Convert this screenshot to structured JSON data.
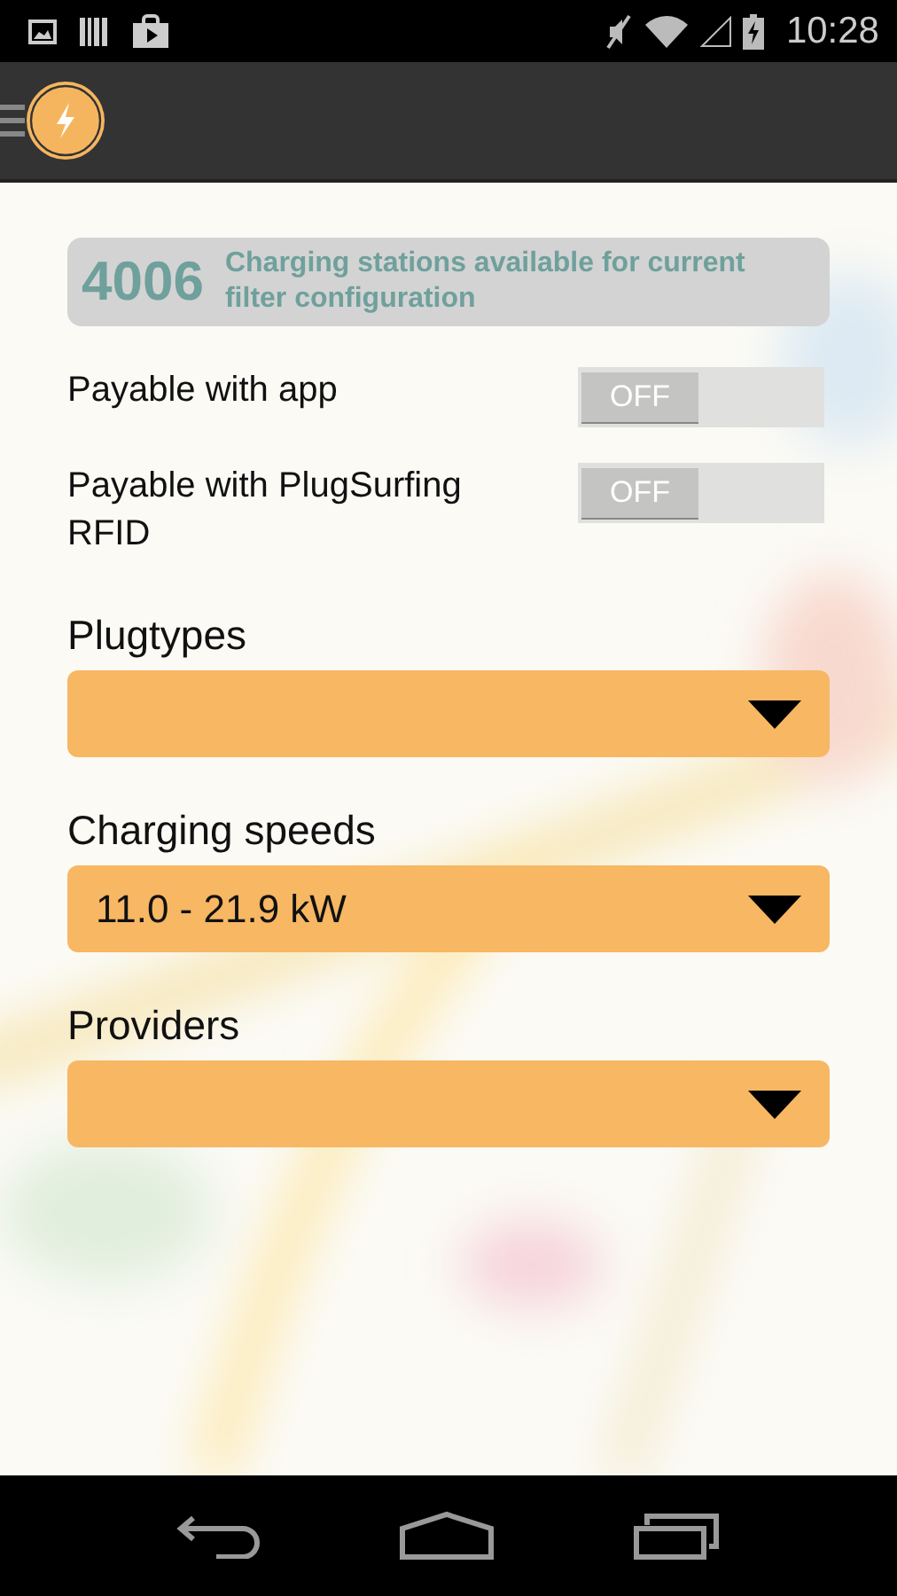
{
  "status_bar": {
    "time": "10:28"
  },
  "summary": {
    "count": "4006",
    "text": "Charging stations available for current filter configuration"
  },
  "toggles": [
    {
      "label": "Payable with app",
      "on": false,
      "state_text": "OFF"
    },
    {
      "label": "Payable with PlugSurfing RFID",
      "on": false,
      "state_text": "OFF"
    }
  ],
  "dropdowns": [
    {
      "label": "Plugtypes"
    },
    {
      "label": "Charging speeds",
      "value": "11.0 - 21.9 kW"
    },
    {
      "label": "Providers"
    }
  ]
}
